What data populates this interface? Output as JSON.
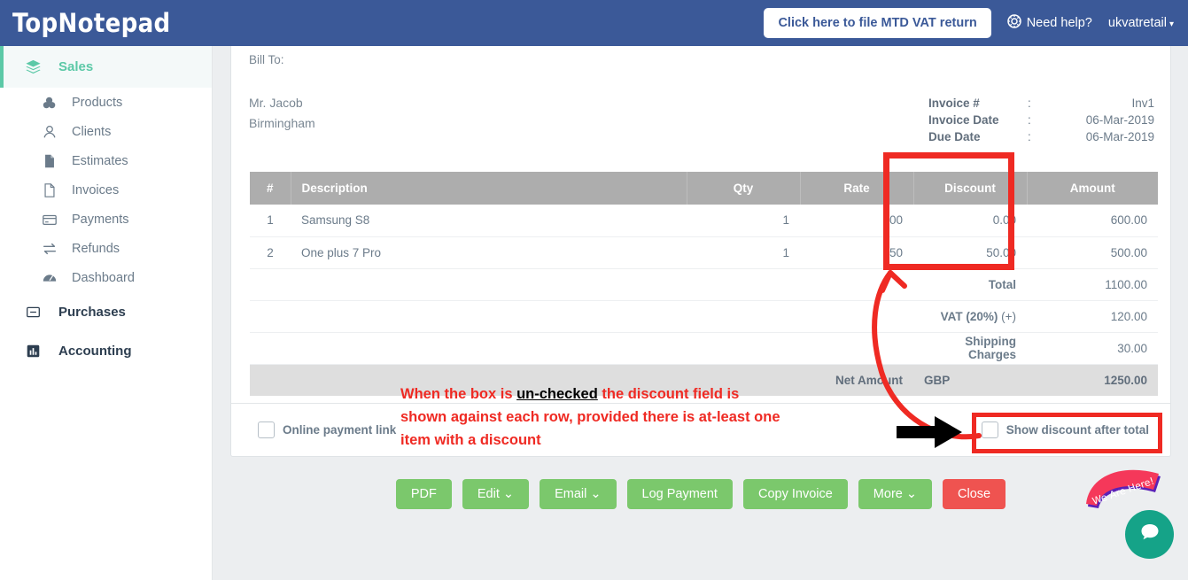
{
  "header": {
    "logo_top": "Top",
    "logo_note": "Notepad",
    "mtd_button": "Click here to file MTD VAT return",
    "need_help": "Need help?",
    "help_icon": "lifebuoy-icon",
    "user": "ukvatretail",
    "caret": "▾",
    "bg_color": "#3b5998"
  },
  "sidebar": {
    "groups": [
      {
        "label": "Sales",
        "icon": "layers-icon",
        "active": true
      },
      {
        "label": "Purchases",
        "icon": "minus-box-icon",
        "active": false
      },
      {
        "label": "Accounting",
        "icon": "bar-chart-icon",
        "active": false
      }
    ],
    "sales_items": [
      {
        "label": "Products",
        "icon": "boxes-icon"
      },
      {
        "label": "Clients",
        "icon": "user-icon"
      },
      {
        "label": "Estimates",
        "icon": "document-filled-icon"
      },
      {
        "label": "Invoices",
        "icon": "document-outline-icon"
      },
      {
        "label": "Payments",
        "icon": "credit-card-icon"
      },
      {
        "label": "Refunds",
        "icon": "exchange-arrows-icon"
      },
      {
        "label": "Dashboard",
        "icon": "gauge-icon"
      }
    ],
    "accent_color": "#5cc9a7"
  },
  "invoice": {
    "bill_to_label": "Bill To:",
    "client_name": "Mr. Jacob",
    "client_city": "Birmingham",
    "meta": [
      {
        "key": "Invoice #",
        "sep": ":",
        "value": "Inv1"
      },
      {
        "key": "Invoice Date",
        "sep": ":",
        "value": "06-Mar-2019"
      },
      {
        "key": "Due Date",
        "sep": ":",
        "value": "06-Mar-2019"
      }
    ],
    "columns": {
      "num": "#",
      "description": "Description",
      "qty": "Qty",
      "rate": "Rate",
      "discount": "Discount",
      "amount": "Amount"
    },
    "rows": [
      {
        "num": "1",
        "description": "Samsung S8",
        "qty": "1",
        "rate": "600",
        "discount": "0.00",
        "amount": "600.00"
      },
      {
        "num": "2",
        "description": "One plus 7 Pro",
        "qty": "1",
        "rate": "550",
        "discount": "50.00",
        "amount": "500.00"
      }
    ],
    "totals": {
      "total_label": "Total",
      "total_value": "1100.00",
      "vat_label": "VAT (20%)",
      "vat_sign": "(+)",
      "vat_value": "120.00",
      "shipping_label": "Shipping Charges",
      "shipping_value": "30.00",
      "net_label": "Net Amount",
      "currency": "GBP",
      "net_value": "1250.00"
    },
    "footer": {
      "online_payment_label": "Online payment link",
      "online_payment_checked": false,
      "show_discount_label": "Show discount after total",
      "show_discount_checked": false
    }
  },
  "actions": [
    {
      "label": "PDF",
      "style": "green",
      "caret": ""
    },
    {
      "label": "Edit",
      "style": "green",
      "caret": "⌄"
    },
    {
      "label": "Email",
      "style": "green",
      "caret": "⌄"
    },
    {
      "label": "Log Payment",
      "style": "green",
      "caret": ""
    },
    {
      "label": "Copy Invoice",
      "style": "green",
      "caret": ""
    },
    {
      "label": "More",
      "style": "green",
      "caret": "⌄"
    },
    {
      "label": "Close",
      "style": "red",
      "caret": ""
    }
  ],
  "annotation": {
    "line1_a": "When the box is ",
    "line1_b": "un-checked",
    "line1_c": " the discount field is",
    "line2": "shown against each row, provided there is at-least one",
    "line3": "item with a discount",
    "color": "#ef2a23",
    "emphasis_color": "#000000"
  },
  "chat": {
    "banner_text": "We Are Here!",
    "banner_color": "#f5385a",
    "bubble_color": "#15a388",
    "bubble_icon": "chat-bubble-icon"
  }
}
